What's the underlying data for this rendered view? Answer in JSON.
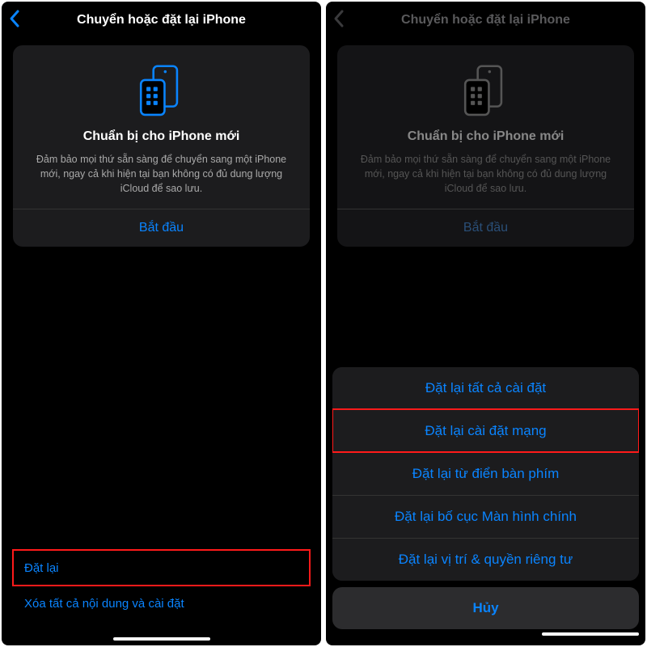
{
  "header": {
    "title": "Chuyển hoặc đặt lại iPhone"
  },
  "card": {
    "title": "Chuẩn bị cho iPhone mới",
    "desc": "Đảm bảo mọi thứ sẵn sàng để chuyển sang một iPhone mới, ngay cả khi hiện tại bạn không có đủ dung lượng iCloud để sao lưu.",
    "action": "Bắt đầu"
  },
  "bottom": {
    "reset": "Đặt lại",
    "erase": "Xóa tất cả nội dung và cài đặt"
  },
  "sheet": {
    "items": [
      "Đặt lại tất cả cài đặt",
      "Đặt lại cài đặt mạng",
      "Đặt lại từ điển bàn phím",
      "Đặt lại bố cục Màn hình chính",
      "Đặt lại vị trí & quyền riêng tư"
    ],
    "cancel": "Hủy"
  },
  "colors": {
    "accent": "#0a84ff",
    "highlight_border": "#ff1a1a"
  }
}
